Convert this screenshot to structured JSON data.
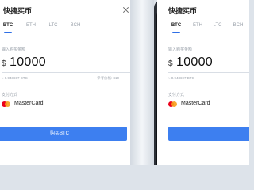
{
  "page": {
    "title": "快捷买币",
    "tabs": [
      "BTC",
      "ETH",
      "LTC",
      "BCH"
    ],
    "active_tab": "BTC",
    "amount_label": "输入购买金额",
    "currency_symbol": "$",
    "amount": "10000",
    "rate_text": "≈ 0.948697 BTC",
    "reference_left": "参考价格: $10",
    "payment_label": "支付方式",
    "payment_method": "MasterCard",
    "buy_button": "购买BTC"
  },
  "colors": {
    "accent": "#3d7ff0",
    "tab_underline": "#2f6fe6",
    "mastercard_red": "#eb001b",
    "mastercard_orange": "#f79e1b"
  },
  "icons": [
    "close-icon",
    "mastercard-icon"
  ]
}
